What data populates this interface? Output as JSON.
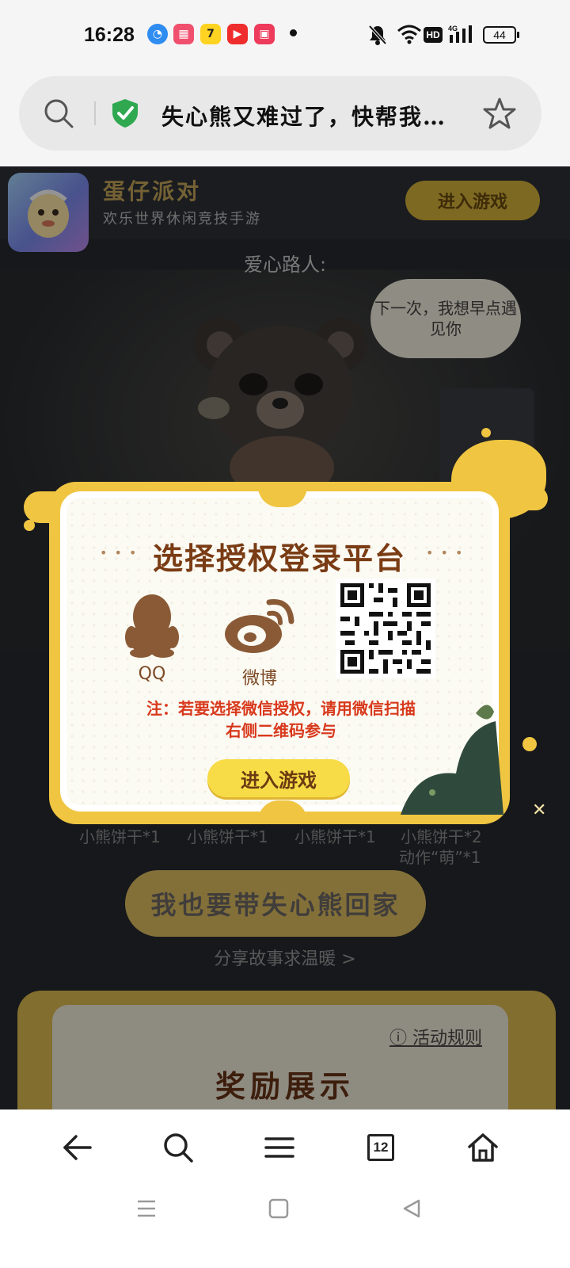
{
  "status_bar": {
    "time": "16:28",
    "hd": "HD",
    "network": "4G",
    "battery": "44"
  },
  "address_bar": {
    "title": "失心熊又难过了，快帮我…"
  },
  "game_banner": {
    "name": "蛋仔派对",
    "tagline": "欢乐世界休闲竞技手游",
    "enter_label": "进入游戏"
  },
  "story": {
    "passerby_label": "爱心路人:",
    "speech": "下一次，我想早点遇见你"
  },
  "rewards": {
    "items": [
      "小熊饼干*1",
      "小熊饼干*1",
      "小熊饼干*1",
      "小熊饼干*2"
    ],
    "item4_extra": "动作“萌”*1",
    "cta_label": "我也要带失心熊回家",
    "share_label": "分享故事求温暖 >",
    "rules_label": "活动规则",
    "section_title": "奖励展示"
  },
  "modal": {
    "title": "选择授权登录平台",
    "decoration": "• • •",
    "qq_label": "QQ",
    "weibo_label": "微博",
    "notice_line1": "注：若要选择微信授权，请用微信扫描",
    "notice_line2": "右侧二维码参与",
    "enter_label": "进入游戏"
  },
  "bottom_nav": {
    "tab_count": "12",
    "icons": [
      "back-arrow-icon",
      "search-icon",
      "menu-icon",
      "tabs-icon",
      "home-icon"
    ]
  },
  "colors": {
    "modal_gold": "#f0c542",
    "modal_title": "#7a3c14",
    "notice_red": "#d8391c",
    "button_yellow": "#f7dc47"
  }
}
